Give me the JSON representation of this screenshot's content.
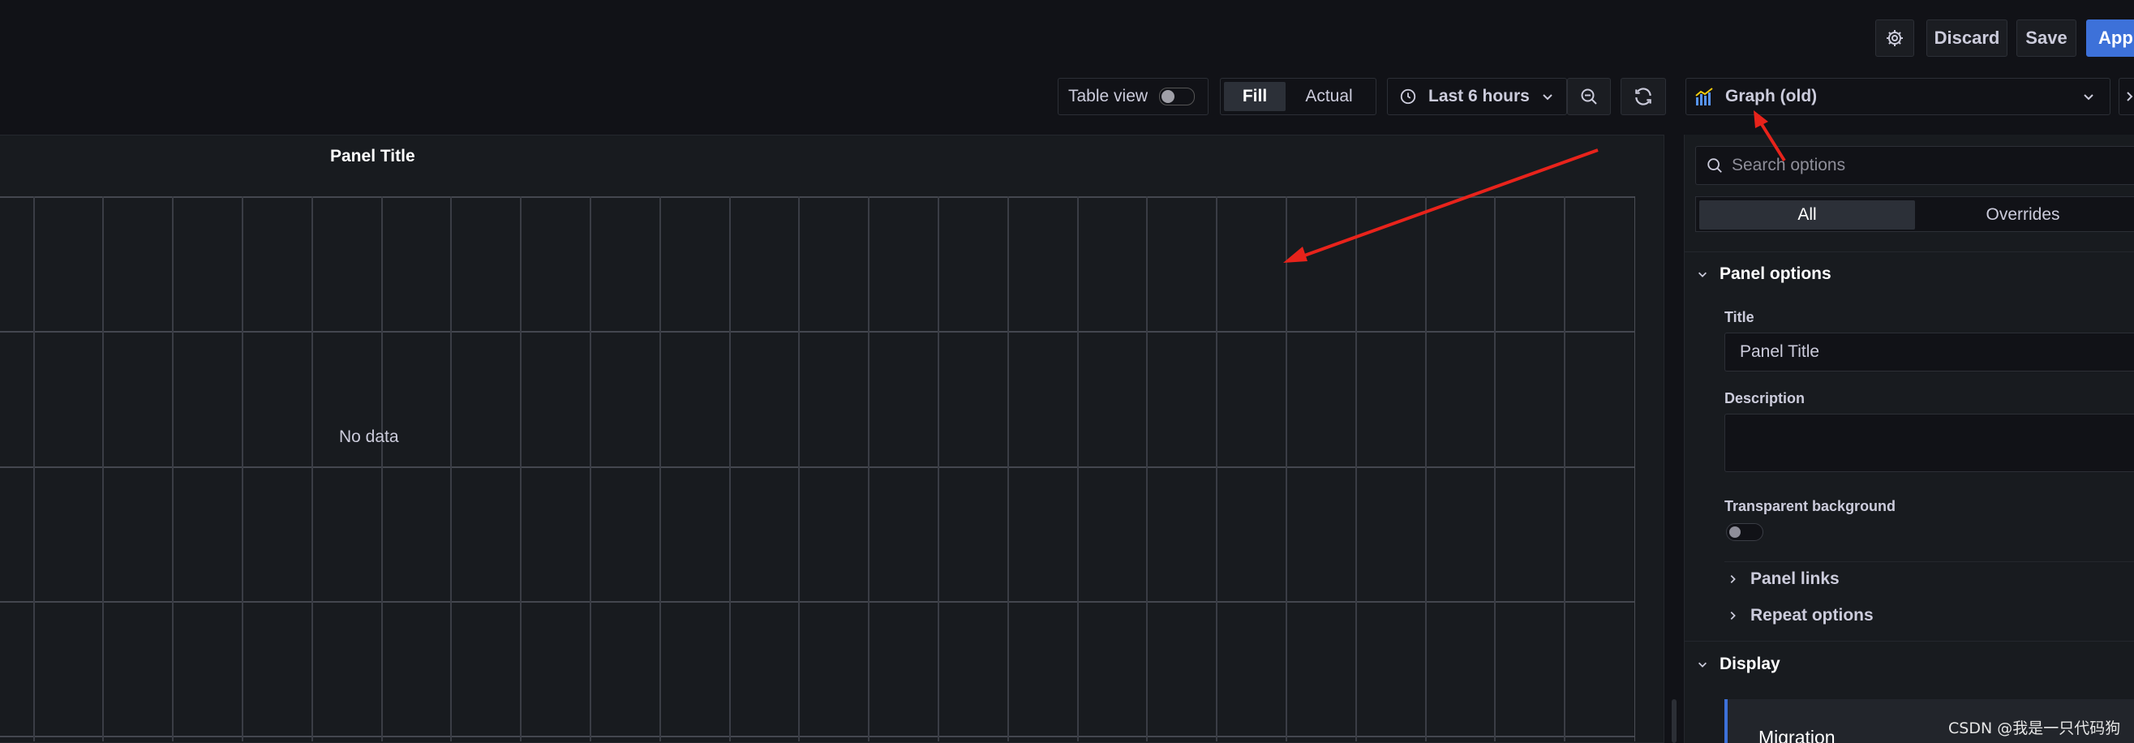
{
  "toolbar": {
    "discard_label": "Discard",
    "save_label": "Save",
    "apply_label": "Apply",
    "table_view_label": "Table view",
    "fill_label": "Fill",
    "actual_label": "Actual",
    "time_range_label": "Last 6 hours"
  },
  "panel": {
    "title": "Panel Title",
    "no_data": "No data"
  },
  "options": {
    "visualization_label": "Graph (old)",
    "search_placeholder": "Search options",
    "tab_all": "All",
    "tab_overrides": "Overrides",
    "section_panel_options": "Panel options",
    "title_label": "Title",
    "title_value": "Panel Title",
    "description_label": "Description",
    "transparent_label": "Transparent background",
    "panel_links": "Panel links",
    "repeat_options": "Repeat options",
    "section_display": "Display",
    "migration_label": "Migration"
  },
  "watermark": "CSDN @我是一只代码狗",
  "colors": {
    "primary": "#3d71d9",
    "annotation": "#e8231b",
    "background": "#111217",
    "panel": "#181b1f"
  }
}
